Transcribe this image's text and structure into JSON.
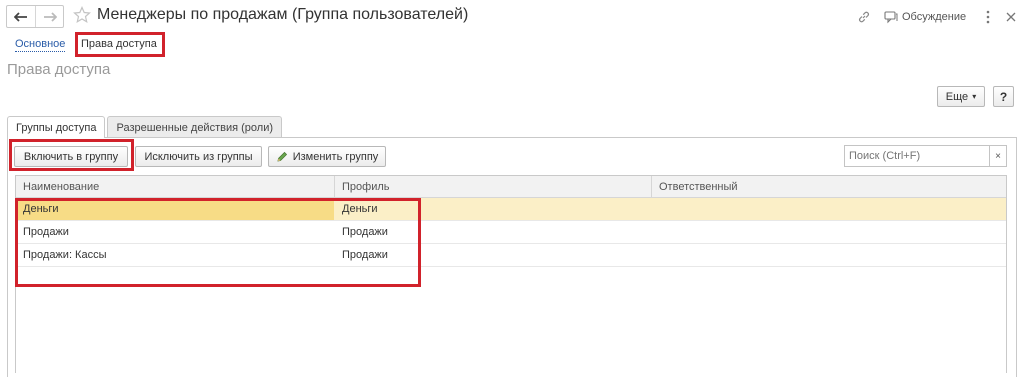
{
  "header": {
    "title": "Менеджеры по продажам (Группа пользователей)",
    "discussion_label": "Обсуждение"
  },
  "form_nav": {
    "basic_label": "Основное",
    "access_label": "Права доступа"
  },
  "section_title": "Права доступа",
  "toolbar_top": {
    "more_label": "Еще",
    "help_label": "?"
  },
  "tabs": [
    {
      "label": "Группы доступа",
      "active": true
    },
    {
      "label": "Разрешенные действия (роли)",
      "active": false
    }
  ],
  "toolbar": {
    "include_label": "Включить в группу",
    "exclude_label": "Исключить из группы",
    "edit_label": "Изменить группу",
    "search_placeholder": "Поиск (Ctrl+F)",
    "clear_label": "×"
  },
  "table": {
    "columns": [
      "Наименование",
      "Профиль",
      "Ответственный"
    ],
    "rows": [
      [
        "Деньги",
        "Деньги",
        ""
      ],
      [
        "Продажи",
        "Продажи",
        ""
      ],
      [
        "Продажи: Кассы",
        "Продажи",
        ""
      ]
    ],
    "selected_row": 0
  },
  "colors": {
    "highlight_red": "#d1222b",
    "selected_row": "#fbefc7",
    "selected_cell": "#f7dc86",
    "link_blue": "#2a5ca8"
  }
}
